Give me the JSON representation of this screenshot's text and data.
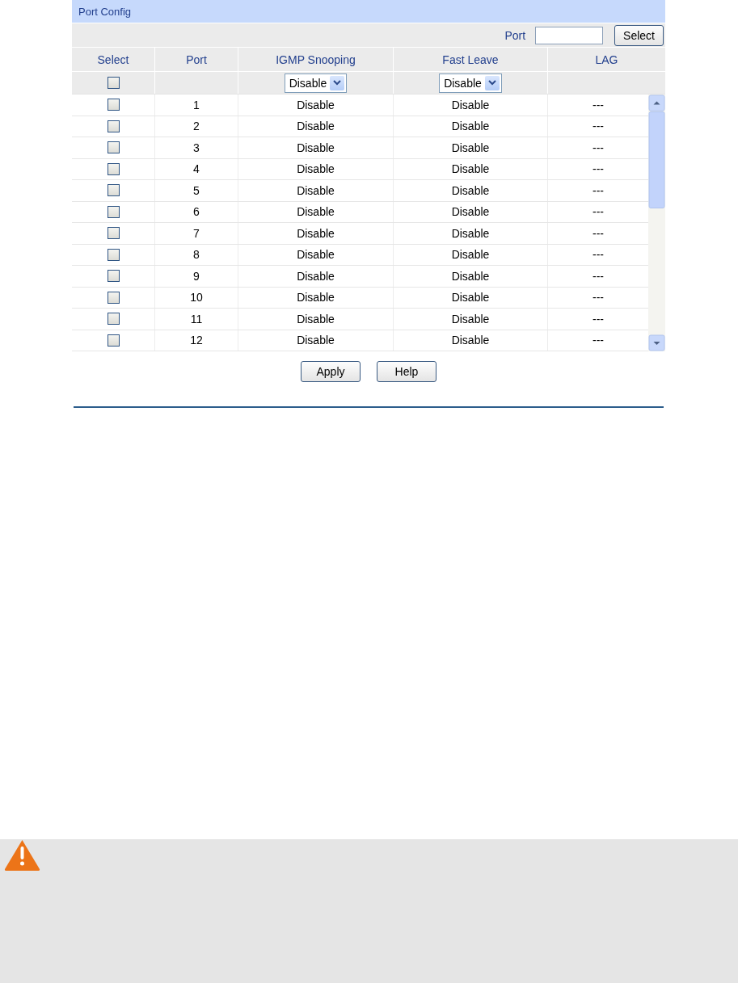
{
  "panel": {
    "title": "Port Config"
  },
  "filter": {
    "label": "Port",
    "button": "Select"
  },
  "columns": [
    "Select",
    "Port",
    "IGMP Snooping",
    "Fast Leave",
    "LAG"
  ],
  "bulk": {
    "checked": false,
    "igmp_snooping": "Disable",
    "fast_leave": "Disable"
  },
  "rows": [
    {
      "checked": false,
      "port": "1",
      "igmp_snooping": "Disable",
      "fast_leave": "Disable",
      "lag": "---"
    },
    {
      "checked": false,
      "port": "2",
      "igmp_snooping": "Disable",
      "fast_leave": "Disable",
      "lag": "---"
    },
    {
      "checked": false,
      "port": "3",
      "igmp_snooping": "Disable",
      "fast_leave": "Disable",
      "lag": "---"
    },
    {
      "checked": false,
      "port": "4",
      "igmp_snooping": "Disable",
      "fast_leave": "Disable",
      "lag": "---"
    },
    {
      "checked": false,
      "port": "5",
      "igmp_snooping": "Disable",
      "fast_leave": "Disable",
      "lag": "---"
    },
    {
      "checked": false,
      "port": "6",
      "igmp_snooping": "Disable",
      "fast_leave": "Disable",
      "lag": "---"
    },
    {
      "checked": false,
      "port": "7",
      "igmp_snooping": "Disable",
      "fast_leave": "Disable",
      "lag": "---"
    },
    {
      "checked": false,
      "port": "8",
      "igmp_snooping": "Disable",
      "fast_leave": "Disable",
      "lag": "---"
    },
    {
      "checked": false,
      "port": "9",
      "igmp_snooping": "Disable",
      "fast_leave": "Disable",
      "lag": "---"
    },
    {
      "checked": false,
      "port": "10",
      "igmp_snooping": "Disable",
      "fast_leave": "Disable",
      "lag": "---"
    },
    {
      "checked": false,
      "port": "11",
      "igmp_snooping": "Disable",
      "fast_leave": "Disable",
      "lag": "---"
    },
    {
      "checked": false,
      "port": "12",
      "igmp_snooping": "Disable",
      "fast_leave": "Disable",
      "lag": "---"
    }
  ],
  "buttons": [
    "Apply",
    "Help"
  ]
}
